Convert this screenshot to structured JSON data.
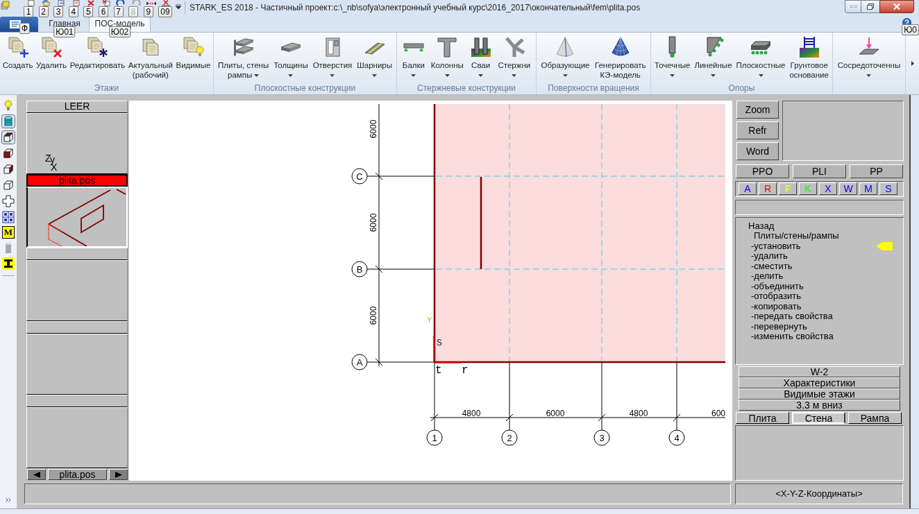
{
  "title_bar": {
    "title": "STARK_ES 2018 - Частичный проект:c:\\_nb\\sofya\\электронный учебный курс\\2016_2017\\окончательный\\fem\\plita.pos",
    "quick_access": [
      {
        "keytip": "1",
        "disabled": false
      },
      {
        "keytip": "2",
        "disabled": false
      },
      {
        "keytip": "3",
        "disabled": false
      },
      {
        "keytip": "4",
        "disabled": false
      },
      {
        "keytip": "5",
        "disabled": false
      },
      {
        "keytip": "6",
        "disabled": false
      },
      {
        "keytip": "7",
        "disabled": false
      },
      {
        "keytip": "8",
        "disabled": true
      },
      {
        "keytip": "9",
        "disabled": false
      },
      {
        "keytip": "09",
        "disabled": false
      }
    ]
  },
  "ribbon": {
    "file_keytip": "Ф",
    "tabs": [
      {
        "label": "Главная",
        "selected": false,
        "keytip": "Ю01"
      },
      {
        "label": "ПОС-модель",
        "selected": true,
        "keytip": "Ю02"
      }
    ],
    "help_keytip": "Ю0",
    "groups": [
      {
        "label": "Этажи",
        "buttons": [
          {
            "lines": [
              "Создать"
            ],
            "dropdown": false
          },
          {
            "lines": [
              "Удалить"
            ],
            "dropdown": false
          },
          {
            "lines": [
              "Редактировать"
            ],
            "dropdown": false
          },
          {
            "lines": [
              "Актуальный",
              "(рабочий)"
            ],
            "dropdown": false
          },
          {
            "lines": [
              "Видимые"
            ],
            "dropdown": false
          }
        ]
      },
      {
        "label": "Плоскостные конструкции",
        "buttons": [
          {
            "lines": [
              "Плиты, стены",
              "рампы"
            ],
            "dropdown": true
          },
          {
            "lines": [
              "Толщины"
            ],
            "dropdown": true
          },
          {
            "lines": [
              "Отверстия"
            ],
            "dropdown": true
          },
          {
            "lines": [
              "Шарниры"
            ],
            "dropdown": true
          }
        ]
      },
      {
        "label": "Стержневые конструкции",
        "buttons": [
          {
            "lines": [
              "Балки"
            ],
            "dropdown": true
          },
          {
            "lines": [
              "Колонны"
            ],
            "dropdown": true
          },
          {
            "lines": [
              "Сваи"
            ],
            "dropdown": true
          },
          {
            "lines": [
              "Стержни"
            ],
            "dropdown": true
          }
        ]
      },
      {
        "label": "Поверхности вращения",
        "buttons": [
          {
            "lines": [
              "Образующие"
            ],
            "dropdown": true
          },
          {
            "lines": [
              "Генерировать",
              "КЭ-модель"
            ],
            "dropdown": false
          }
        ]
      },
      {
        "label": "Опоры",
        "buttons": [
          {
            "lines": [
              "Точечные"
            ],
            "dropdown": true
          },
          {
            "lines": [
              "Линейные"
            ],
            "dropdown": true
          },
          {
            "lines": [
              "Плоскостные"
            ],
            "dropdown": true
          },
          {
            "lines": [
              "Грунтовое",
              "основание"
            ],
            "dropdown": false
          }
        ]
      },
      {
        "buttons": [
          {
            "lines": [
              "Сосредоточенны"
            ],
            "dropdown": true
          }
        ]
      }
    ]
  },
  "left_toolbar": [
    {
      "pressed": false
    },
    {
      "pressed": true
    },
    {
      "pressed": true
    },
    {
      "pressed": false
    },
    {
      "pressed": false
    },
    {
      "pressed": false
    },
    {
      "pressed": false
    },
    {
      "pressed": false
    },
    {
      "pressed": false,
      "label": "M"
    },
    {
      "pressed": false
    },
    {
      "pressed": false
    }
  ],
  "layers": {
    "slots": [
      {
        "name": "LEER",
        "selected": false,
        "kind": "axes",
        "axis_labels": [
          "Z",
          "y",
          "X"
        ]
      },
      {
        "name": "plita.pos",
        "selected": true,
        "kind": "plate"
      },
      {
        "selected": false,
        "kind": "empty"
      },
      {
        "selected": false,
        "kind": "empty"
      },
      {
        "selected": false,
        "kind": "empty"
      }
    ],
    "navigator": "plita.pos"
  },
  "drawing": {
    "row_axes": [
      "C",
      "B",
      "A"
    ],
    "column_axes": [
      "1",
      "2",
      "3",
      "4"
    ],
    "row_dimensions": [
      "6000",
      "6000",
      "6000"
    ],
    "column_dimensions": [
      "4800",
      "6000",
      "4800",
      "600"
    ],
    "origin_labels": [
      "Y",
      "S",
      "t",
      "r"
    ]
  },
  "right_panel": {
    "view_buttons": [
      "Zoom",
      "Refr",
      "Word"
    ],
    "mode_buttons": [
      "PPO",
      "PLI",
      "PP"
    ],
    "filters": [
      {
        "label": "A",
        "color": "#0000ff"
      },
      {
        "label": "R",
        "color": "#ff0000"
      },
      {
        "label": "F",
        "color": "#ffff00"
      },
      {
        "label": "K",
        "color": "#00ff00"
      },
      {
        "label": "X",
        "color": "#0000ff"
      },
      {
        "label": "W",
        "color": "#0000ff"
      },
      {
        "label": "M",
        "color": "#0000ff"
      },
      {
        "label": "S",
        "color": "#0000ff"
      }
    ],
    "menu": {
      "back": "Назад",
      "title": "Плиты/стены/рампы",
      "items": [
        {
          "label": "-установить",
          "selected": true
        },
        {
          "label": "-удалить",
          "selected": false
        },
        {
          "label": "-сместить",
          "selected": false
        },
        {
          "label": "-делить",
          "selected": false
        },
        {
          "label": "-объединить",
          "selected": false
        },
        {
          "label": "-отобразить",
          "selected": false
        },
        {
          "label": "-копировать",
          "selected": false
        },
        {
          "label": "-передать свойства",
          "selected": false
        },
        {
          "label": "-перевернуть",
          "selected": false
        },
        {
          "label": "-изменить свойства",
          "selected": false
        }
      ]
    },
    "properties": [
      "W-2",
      "Характеристики",
      "Видимые этажи",
      "3.3 м вниз"
    ],
    "element_tabs": [
      {
        "label": "Плита",
        "selected": false
      },
      {
        "label": "Стена",
        "selected": true
      },
      {
        "label": "Рампа",
        "selected": false
      }
    ]
  },
  "status_bar": {
    "coordinates": "<X-Y-Z-Координаты>"
  }
}
